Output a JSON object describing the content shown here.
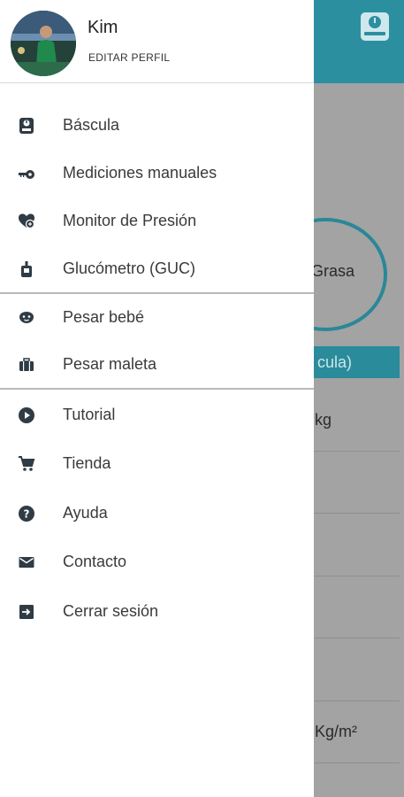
{
  "background": {
    "circle_label": "Grasa",
    "banner_text": "cula)",
    "row_units": [
      "kg",
      "Kg/m²"
    ]
  },
  "drawer": {
    "user": {
      "name": "Kim",
      "edit_profile_label": "EDITAR PERFIL"
    },
    "groups": [
      [
        {
          "label": "Báscula",
          "icon": "scale-icon"
        },
        {
          "label": "Mediciones manuales",
          "icon": "tape-measure-icon"
        },
        {
          "label": "Monitor de Presión",
          "icon": "heart-pressure-icon"
        },
        {
          "label": "Glucómetro (GUC)",
          "icon": "glucometer-icon"
        }
      ],
      [
        {
          "label": "Pesar bebé",
          "icon": "baby-icon"
        },
        {
          "label": "Pesar maleta",
          "icon": "suitcase-icon"
        }
      ],
      [
        {
          "label": "Tutorial",
          "icon": "play-circle-icon"
        },
        {
          "label": "Tienda",
          "icon": "cart-icon"
        },
        {
          "label": "Ayuda",
          "icon": "help-circle-icon"
        },
        {
          "label": "Contacto",
          "icon": "mail-icon"
        },
        {
          "label": "Cerrar sesión",
          "icon": "logout-icon"
        }
      ]
    ]
  },
  "colors": {
    "accent": "#2b8fa0",
    "icon": "#2f3b45"
  }
}
